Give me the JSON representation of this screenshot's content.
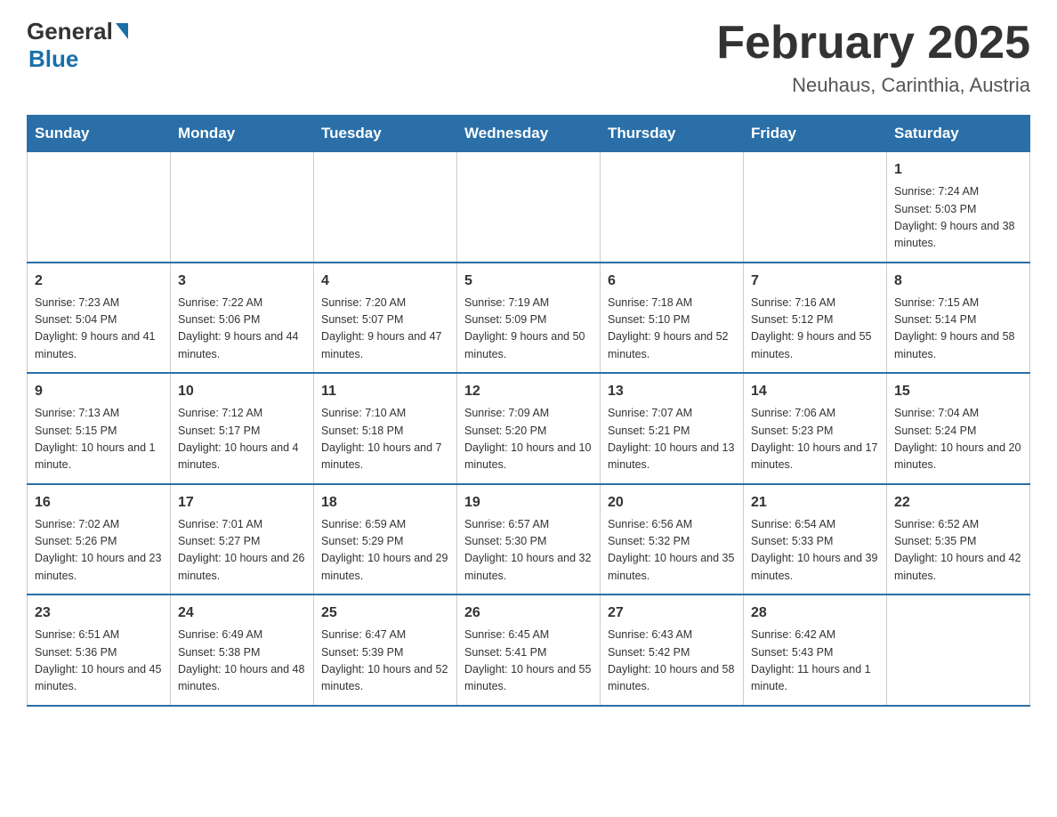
{
  "logo": {
    "general": "General",
    "blue": "Blue"
  },
  "title": "February 2025",
  "subtitle": "Neuhaus, Carinthia, Austria",
  "days_of_week": [
    "Sunday",
    "Monday",
    "Tuesday",
    "Wednesday",
    "Thursday",
    "Friday",
    "Saturday"
  ],
  "weeks": [
    [
      {
        "day": "",
        "sunrise": "",
        "sunset": "",
        "daylight": ""
      },
      {
        "day": "",
        "sunrise": "",
        "sunset": "",
        "daylight": ""
      },
      {
        "day": "",
        "sunrise": "",
        "sunset": "",
        "daylight": ""
      },
      {
        "day": "",
        "sunrise": "",
        "sunset": "",
        "daylight": ""
      },
      {
        "day": "",
        "sunrise": "",
        "sunset": "",
        "daylight": ""
      },
      {
        "day": "",
        "sunrise": "",
        "sunset": "",
        "daylight": ""
      },
      {
        "day": "1",
        "sunrise": "Sunrise: 7:24 AM",
        "sunset": "Sunset: 5:03 PM",
        "daylight": "Daylight: 9 hours and 38 minutes."
      }
    ],
    [
      {
        "day": "2",
        "sunrise": "Sunrise: 7:23 AM",
        "sunset": "Sunset: 5:04 PM",
        "daylight": "Daylight: 9 hours and 41 minutes."
      },
      {
        "day": "3",
        "sunrise": "Sunrise: 7:22 AM",
        "sunset": "Sunset: 5:06 PM",
        "daylight": "Daylight: 9 hours and 44 minutes."
      },
      {
        "day": "4",
        "sunrise": "Sunrise: 7:20 AM",
        "sunset": "Sunset: 5:07 PM",
        "daylight": "Daylight: 9 hours and 47 minutes."
      },
      {
        "day": "5",
        "sunrise": "Sunrise: 7:19 AM",
        "sunset": "Sunset: 5:09 PM",
        "daylight": "Daylight: 9 hours and 50 minutes."
      },
      {
        "day": "6",
        "sunrise": "Sunrise: 7:18 AM",
        "sunset": "Sunset: 5:10 PM",
        "daylight": "Daylight: 9 hours and 52 minutes."
      },
      {
        "day": "7",
        "sunrise": "Sunrise: 7:16 AM",
        "sunset": "Sunset: 5:12 PM",
        "daylight": "Daylight: 9 hours and 55 minutes."
      },
      {
        "day": "8",
        "sunrise": "Sunrise: 7:15 AM",
        "sunset": "Sunset: 5:14 PM",
        "daylight": "Daylight: 9 hours and 58 minutes."
      }
    ],
    [
      {
        "day": "9",
        "sunrise": "Sunrise: 7:13 AM",
        "sunset": "Sunset: 5:15 PM",
        "daylight": "Daylight: 10 hours and 1 minute."
      },
      {
        "day": "10",
        "sunrise": "Sunrise: 7:12 AM",
        "sunset": "Sunset: 5:17 PM",
        "daylight": "Daylight: 10 hours and 4 minutes."
      },
      {
        "day": "11",
        "sunrise": "Sunrise: 7:10 AM",
        "sunset": "Sunset: 5:18 PM",
        "daylight": "Daylight: 10 hours and 7 minutes."
      },
      {
        "day": "12",
        "sunrise": "Sunrise: 7:09 AM",
        "sunset": "Sunset: 5:20 PM",
        "daylight": "Daylight: 10 hours and 10 minutes."
      },
      {
        "day": "13",
        "sunrise": "Sunrise: 7:07 AM",
        "sunset": "Sunset: 5:21 PM",
        "daylight": "Daylight: 10 hours and 13 minutes."
      },
      {
        "day": "14",
        "sunrise": "Sunrise: 7:06 AM",
        "sunset": "Sunset: 5:23 PM",
        "daylight": "Daylight: 10 hours and 17 minutes."
      },
      {
        "day": "15",
        "sunrise": "Sunrise: 7:04 AM",
        "sunset": "Sunset: 5:24 PM",
        "daylight": "Daylight: 10 hours and 20 minutes."
      }
    ],
    [
      {
        "day": "16",
        "sunrise": "Sunrise: 7:02 AM",
        "sunset": "Sunset: 5:26 PM",
        "daylight": "Daylight: 10 hours and 23 minutes."
      },
      {
        "day": "17",
        "sunrise": "Sunrise: 7:01 AM",
        "sunset": "Sunset: 5:27 PM",
        "daylight": "Daylight: 10 hours and 26 minutes."
      },
      {
        "day": "18",
        "sunrise": "Sunrise: 6:59 AM",
        "sunset": "Sunset: 5:29 PM",
        "daylight": "Daylight: 10 hours and 29 minutes."
      },
      {
        "day": "19",
        "sunrise": "Sunrise: 6:57 AM",
        "sunset": "Sunset: 5:30 PM",
        "daylight": "Daylight: 10 hours and 32 minutes."
      },
      {
        "day": "20",
        "sunrise": "Sunrise: 6:56 AM",
        "sunset": "Sunset: 5:32 PM",
        "daylight": "Daylight: 10 hours and 35 minutes."
      },
      {
        "day": "21",
        "sunrise": "Sunrise: 6:54 AM",
        "sunset": "Sunset: 5:33 PM",
        "daylight": "Daylight: 10 hours and 39 minutes."
      },
      {
        "day": "22",
        "sunrise": "Sunrise: 6:52 AM",
        "sunset": "Sunset: 5:35 PM",
        "daylight": "Daylight: 10 hours and 42 minutes."
      }
    ],
    [
      {
        "day": "23",
        "sunrise": "Sunrise: 6:51 AM",
        "sunset": "Sunset: 5:36 PM",
        "daylight": "Daylight: 10 hours and 45 minutes."
      },
      {
        "day": "24",
        "sunrise": "Sunrise: 6:49 AM",
        "sunset": "Sunset: 5:38 PM",
        "daylight": "Daylight: 10 hours and 48 minutes."
      },
      {
        "day": "25",
        "sunrise": "Sunrise: 6:47 AM",
        "sunset": "Sunset: 5:39 PM",
        "daylight": "Daylight: 10 hours and 52 minutes."
      },
      {
        "day": "26",
        "sunrise": "Sunrise: 6:45 AM",
        "sunset": "Sunset: 5:41 PM",
        "daylight": "Daylight: 10 hours and 55 minutes."
      },
      {
        "day": "27",
        "sunrise": "Sunrise: 6:43 AM",
        "sunset": "Sunset: 5:42 PM",
        "daylight": "Daylight: 10 hours and 58 minutes."
      },
      {
        "day": "28",
        "sunrise": "Sunrise: 6:42 AM",
        "sunset": "Sunset: 5:43 PM",
        "daylight": "Daylight: 11 hours and 1 minute."
      },
      {
        "day": "",
        "sunrise": "",
        "sunset": "",
        "daylight": ""
      }
    ]
  ]
}
